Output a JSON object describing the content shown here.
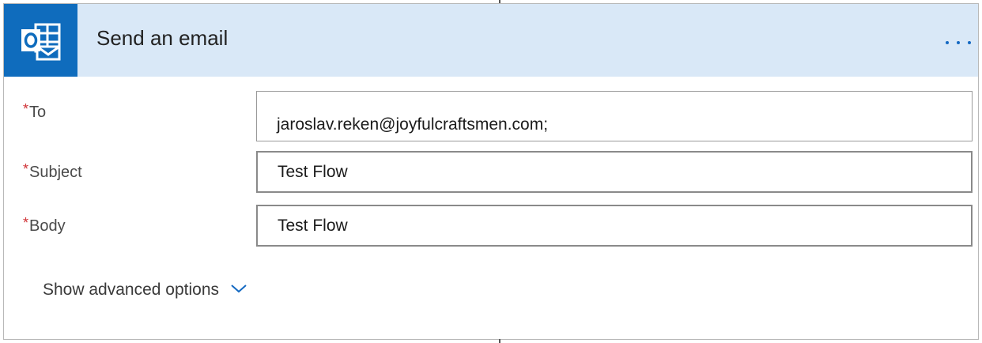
{
  "action": {
    "title": "Send an email",
    "icon": "outlook-icon",
    "menu_icon": "more-options-icon"
  },
  "fields": {
    "to": {
      "label": "To",
      "required_mark": "*",
      "value": "jaroslav.reken@joyfulcraftsmen.com;"
    },
    "subject": {
      "label": "Subject",
      "required_mark": "*",
      "value": "Test Flow"
    },
    "body": {
      "label": "Body",
      "required_mark": "*",
      "value": "Test Flow"
    }
  },
  "advanced": {
    "label": "Show advanced options",
    "icon": "chevron-down-icon"
  },
  "colors": {
    "header_bg": "#d9e8f7",
    "icon_bg": "#0f6cbd",
    "accent": "#1469c2",
    "required": "#d13438"
  }
}
